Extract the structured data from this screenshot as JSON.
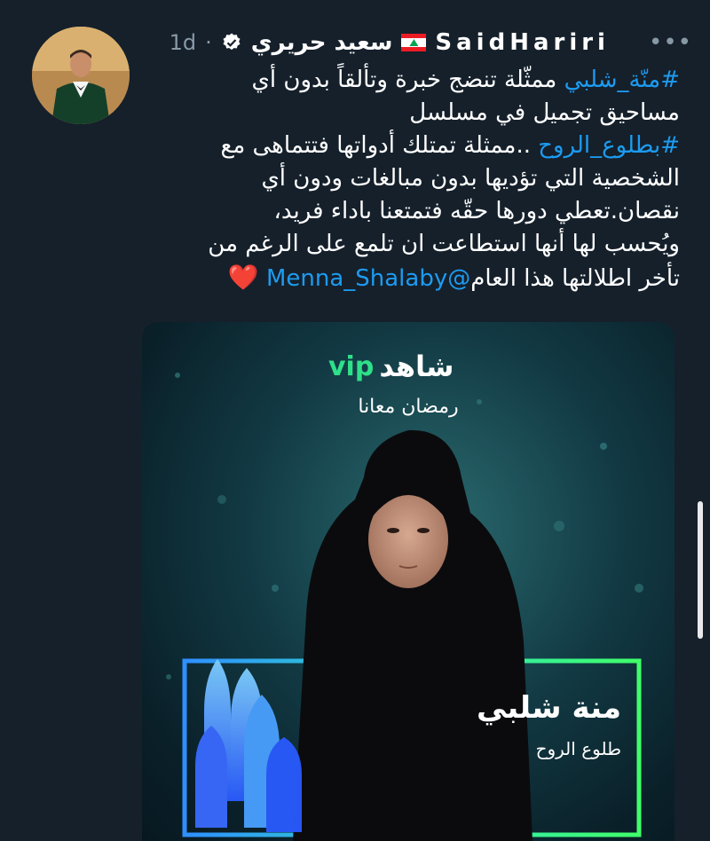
{
  "tweet": {
    "author": {
      "name_latin": "SaidHariri",
      "name_arabic": "سعيد حريري",
      "flag_icon": "lebanon-flag-icon",
      "verified_icon": "verified-badge-icon"
    },
    "separator": "·",
    "time": "1d",
    "more_label": "•••",
    "text": {
      "line1_hashtag": "#منّة_شلبي",
      "line1_rest": " ممثّلة تنضج خبرة وتألقاً بدون أي",
      "line2": "مساحيق تجميل في مسلسل",
      "line3_hashtag": "#بطلوع_الروح",
      "line3_rest": " ..ممثلة تمتلك أدواتها فتتماهى مع",
      "line4": "الشخصية التي تؤديها بدون مبالغات ودون أي",
      "line5": "نقصان.تعطي دورها حقّه فتمتعنا باداء فريد،",
      "line6": "ويُحسب لها أنها استطاعت ان تلمع على الرغم من",
      "line7_text": "تأخر اطلالتها هذا العام",
      "line7_mention": "@Menna_Shalaby",
      "line7_emoji": "❤️"
    },
    "media": {
      "logo_vip": "vip",
      "logo_shahid": "شاهد",
      "tagline": "رمضان معانا",
      "actor_name": "منة شلبي",
      "show_title": "طلوع الروح",
      "accent_color": "#2fe08a"
    }
  }
}
